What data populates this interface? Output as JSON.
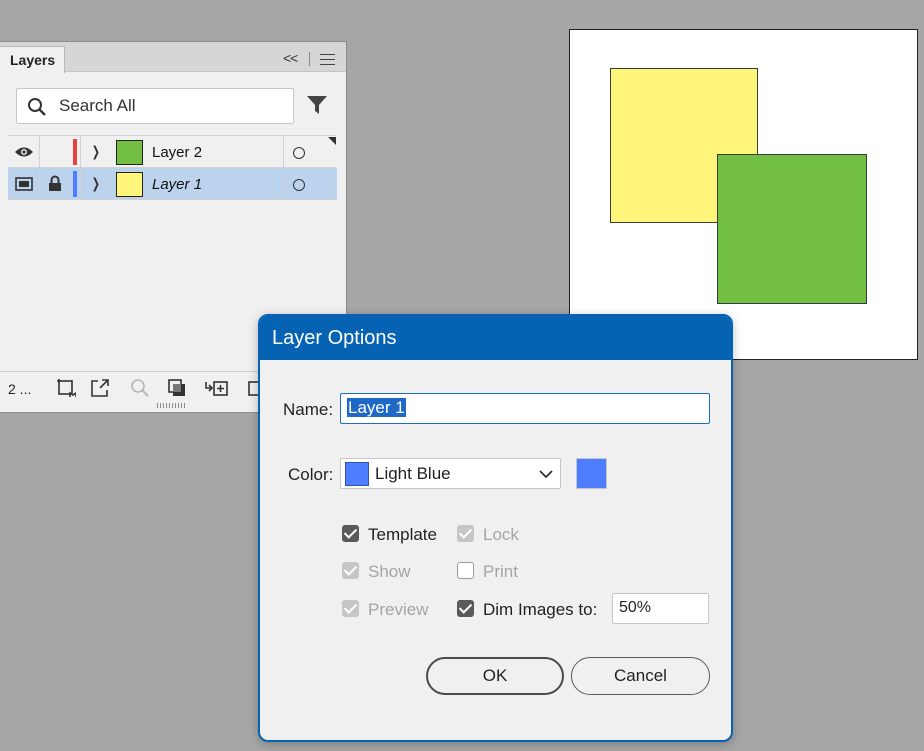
{
  "layers_panel": {
    "tab_label": "Layers",
    "collapse_label": "<<",
    "search_placeholder": "Search All",
    "layers": [
      {
        "name": "Layer 2",
        "color": "#e8423f",
        "thumb_color": "#72bf44",
        "visible": true,
        "locked": false,
        "template": false,
        "selected": false
      },
      {
        "name": "Layer 1",
        "color": "#4f7dff",
        "thumb_color": "#fff57a",
        "visible": true,
        "locked": true,
        "template": true,
        "selected": true
      }
    ],
    "layer_count": "2 ..."
  },
  "artboard": {
    "shapes": [
      {
        "name": "yellow-square",
        "fill": "#fff57a"
      },
      {
        "name": "green-square",
        "fill": "#72bf44"
      }
    ]
  },
  "dialog": {
    "title": "Layer Options",
    "name_label": "Name:",
    "name_value": "Layer 1",
    "color_label": "Color:",
    "color_value": "Light Blue",
    "color_hex": "#4f7dff",
    "options": {
      "template": {
        "label": "Template",
        "checked": true,
        "enabled": true
      },
      "lock": {
        "label": "Lock",
        "checked": true,
        "enabled": false
      },
      "show": {
        "label": "Show",
        "checked": true,
        "enabled": false
      },
      "print": {
        "label": "Print",
        "checked": false,
        "enabled": false
      },
      "preview": {
        "label": "Preview",
        "checked": true,
        "enabled": false
      },
      "dim_images": {
        "label": "Dim Images to:",
        "checked": true,
        "enabled": true
      }
    },
    "dim_value": "50%",
    "ok_label": "OK",
    "cancel_label": "Cancel"
  }
}
